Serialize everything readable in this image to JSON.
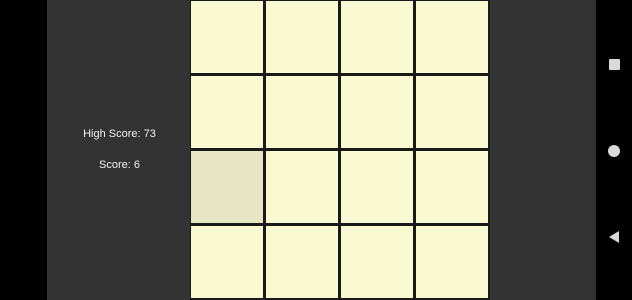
{
  "scores": {
    "high_score": "High Score: 73",
    "score": "Score: 6"
  },
  "board": {
    "rows": 4,
    "cols": 4,
    "highlighted_tiles": [
      {
        "row": 2,
        "col": 0
      }
    ],
    "colors": {
      "tile": "#fafad2",
      "tile_highlight": "#e6e6c4",
      "grid_line": "#1a1a1a",
      "background": "#333333"
    }
  },
  "navigation_bar": {
    "buttons": [
      "recents-icon",
      "home-icon",
      "back-icon"
    ]
  }
}
